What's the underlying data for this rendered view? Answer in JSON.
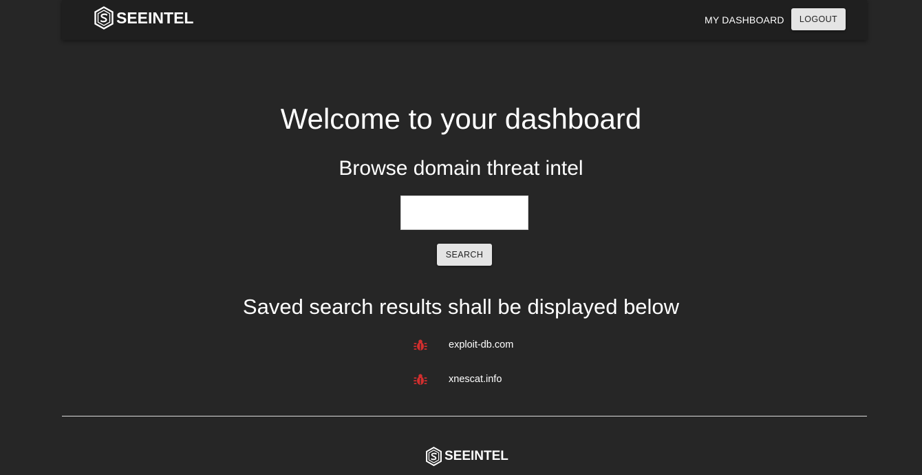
{
  "header": {
    "brand": "SEEINTEL",
    "nav_dashboard": "MY DASHBOARD",
    "logout_label": "LOGOUT"
  },
  "main": {
    "welcome_title": "Welcome to your dashboard",
    "browse_title": "Browse domain threat intel",
    "search": {
      "value": "",
      "placeholder": "",
      "button_label": "SEARCH"
    },
    "saved_title": "Saved search results shall be displayed below",
    "saved_results": [
      {
        "domain": "exploit-db.com",
        "icon": "bug-icon"
      },
      {
        "domain": "xnescat.info",
        "icon": "bug-icon"
      }
    ]
  },
  "footer": {
    "brand": "SEEINTEL"
  },
  "colors": {
    "background": "#262626",
    "navbar": "#1f1f1f",
    "button": "#e4e4e4",
    "bug_icon": "#d32f2f",
    "text": "#ffffff"
  }
}
